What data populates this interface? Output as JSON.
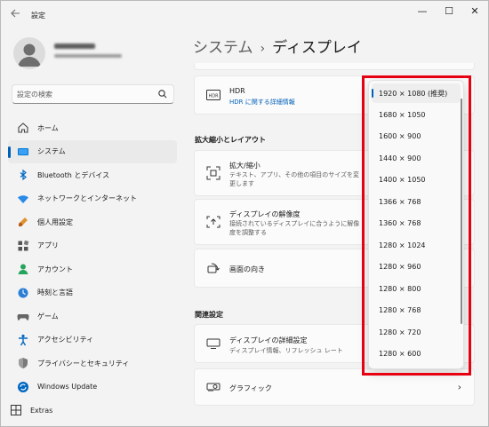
{
  "window": {
    "title": "設定",
    "minimize_glyph": "—",
    "maximize_glyph": "☐",
    "close_glyph": "✕"
  },
  "search": {
    "placeholder": "設定の検索"
  },
  "nav": {
    "items": [
      {
        "label": "ホーム",
        "icon": "home-icon"
      },
      {
        "label": "システム",
        "icon": "system-monitor-icon",
        "active": true
      },
      {
        "label": "Bluetooth とデバイス",
        "icon": "bluetooth-icon"
      },
      {
        "label": "ネットワークとインターネット",
        "icon": "wifi-icon"
      },
      {
        "label": "個人用設定",
        "icon": "paintbrush-icon"
      },
      {
        "label": "アプリ",
        "icon": "apps-icon"
      },
      {
        "label": "アカウント",
        "icon": "account-icon"
      },
      {
        "label": "時刻と言語",
        "icon": "globe-clock-icon"
      },
      {
        "label": "ゲーム",
        "icon": "gamepad-icon"
      },
      {
        "label": "アクセシビリティ",
        "icon": "accessibility-icon"
      },
      {
        "label": "プライバシーとセキュリティ",
        "icon": "shield-icon"
      },
      {
        "label": "Windows Update",
        "icon": "update-icon"
      }
    ],
    "extras_label": "Extras"
  },
  "breadcrumb": {
    "root": "システム",
    "separator": "›",
    "current": "ディスプレイ"
  },
  "hdr_card": {
    "title": "HDR",
    "link": "HDR に関する詳細情報",
    "icon_text": "HDR"
  },
  "scale_section": {
    "heading": "拡大縮小とレイアウト",
    "scale": {
      "title": "拡大/縮小",
      "desc": "テキスト、アプリ、その他の項目のサイズを変更します"
    },
    "resolution": {
      "title": "ディスプレイの解像度",
      "desc": "接続されているディスプレイに合うように解像度を調整する"
    },
    "orientation": {
      "title": "画面の向き"
    }
  },
  "related_section": {
    "heading": "関連設定",
    "advanced": {
      "title": "ディスプレイの詳細設定",
      "desc": "ディスプレイ情報、リフレッシュ レート"
    },
    "graphics": {
      "title": "グラフィック",
      "chevron": "›"
    }
  },
  "resolution_dropdown": {
    "options": [
      "1920 × 1080 (推奨)",
      "1680 × 1050",
      "1600 × 900",
      "1440 × 900",
      "1400 × 1050",
      "1366 × 768",
      "1360 × 768",
      "1280 × 1024",
      "1280 × 960",
      "1280 × 800",
      "1280 × 768",
      "1280 × 720",
      "1280 × 600"
    ],
    "selected_index": 0
  },
  "colors": {
    "accent": "#005fb8",
    "highlight": "#e60012"
  }
}
